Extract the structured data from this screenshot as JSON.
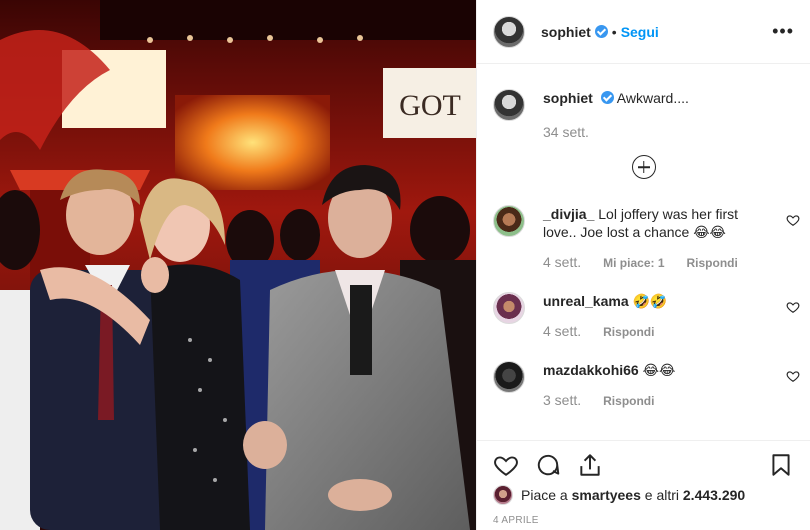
{
  "post": {
    "author": "sophiet",
    "follow_label": "Segui",
    "dot": "•",
    "more_label": "•••",
    "sign_text": "GOT"
  },
  "caption": {
    "username": "sophiet",
    "text": "Awkward....",
    "time": "34 sett."
  },
  "comments": [
    {
      "username": "_divjia_",
      "text": "Lol joffery was her first love.. Joe lost a chance 😂😂",
      "time": "4 sett.",
      "likes": "Mi piace: 1",
      "reply": "Rispondi"
    },
    {
      "username": "unreal_kama",
      "text": "🤣🤣",
      "time": "4 sett.",
      "reply": "Rispondi"
    },
    {
      "username": "mazdakkohi66",
      "text": "😂😂",
      "time": "3 sett.",
      "reply": "Rispondi"
    }
  ],
  "likes": {
    "prefix": "Piace a",
    "liker": "smartyees",
    "middle": "e altri",
    "count": "2.443.290"
  },
  "date": "4 APRILE",
  "icons": [
    "heart-icon",
    "comment-icon",
    "share-icon",
    "bookmark-icon",
    "plus-circle-icon",
    "verified-icon"
  ],
  "colors": {
    "accent": "#0095f6",
    "verified": "#3897f0",
    "muted": "#8e8e8e"
  }
}
